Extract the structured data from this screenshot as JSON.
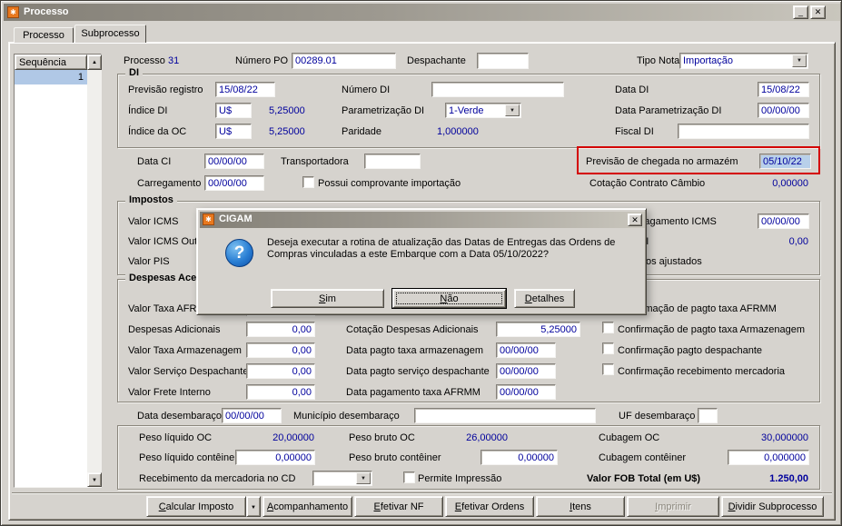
{
  "colors": {
    "value_text": "#00009c",
    "annotation_red": "#d40000",
    "field_highlight": "#b8d0ea",
    "window_bg": "#d6d3ce"
  },
  "glyphs": {
    "app_icon": "✱",
    "minimize": "_",
    "close": "✕",
    "dropdown": "▼",
    "scroll_up": "▲",
    "scroll_down": "▼",
    "question": "?"
  },
  "window": {
    "title": "Processo"
  },
  "tabs": {
    "processo": "Processo",
    "subprocesso": "Subprocesso"
  },
  "sequencia": {
    "header": "Sequência",
    "row1": "1"
  },
  "top": {
    "processo_label": "Processo",
    "processo_value": "31",
    "numero_po_label": "Número PO",
    "numero_po_value": "00289.01",
    "despachante_label": "Despachante",
    "despachante_value": "",
    "tipo_nota_label": "Tipo Nota",
    "tipo_nota_value": "Importação"
  },
  "di": {
    "title": "DI",
    "previsao_registro_label": "Previsão registro",
    "previsao_registro_value": "15/08/22",
    "numero_di_label": "Número DI",
    "numero_di_value": "",
    "data_di_label": "Data DI",
    "data_di_value": "15/08/22",
    "indice_di_label": "Índice DI",
    "indice_di_moeda": "U$",
    "indice_di_taxa": "5,25000",
    "parametrizacao_di_label": "Parametrização DI",
    "parametrizacao_di_value": "1-Verde",
    "data_parametrizacao_di_label": "Data Parametrização DI",
    "data_parametrizacao_di_value": "00/00/00",
    "indice_oc_label": "Índice da OC",
    "indice_oc_moeda": "U$",
    "indice_oc_taxa": "5,25000",
    "paridade_label": "Paridade",
    "paridade_value": "1,000000",
    "fiscal_di_label": "Fiscal DI",
    "fiscal_di_value": ""
  },
  "mid": {
    "data_ci_label": "Data CI",
    "data_ci_value": "00/00/00",
    "transportadora_label": "Transportadora",
    "transportadora_value": "",
    "previsao_chegada_label": "Previsão de chegada no armazém",
    "previsao_chegada_value": "05/10/22",
    "carregamento_label": "Carregamento",
    "carregamento_value": "00/00/00",
    "possui_comprovante_label": "Possui comprovante importação",
    "cotacao_contrato_label": "Cotação Contrato Câmbio",
    "cotacao_contrato_value": "0,00000"
  },
  "impostos": {
    "title": "Impostos",
    "valor_icms_label": "Valor ICMS",
    "valor_icms_value": "",
    "valor_icms_outros_label": "Valor ICMS Outros",
    "valor_icms_outros_value": "",
    "valor_pis_label": "Valor PIS",
    "valor_pis_value": "",
    "data_pagamento_icms_label": "Data pagamento ICMS",
    "data_pagamento_icms_value": "00/00/00",
    "valor_ipi_label": "Valor IPI",
    "valor_ipi_value": "0,00",
    "impostos_ajustados_label": "Impostos ajustados"
  },
  "despesas": {
    "title": "Despesas Acessórias",
    "valor_taxa_afrmm_label": "Valor Taxa AFRMM",
    "valor_taxa_afrmm_value": "",
    "despesas_adicionais_label": "Despesas Adicionais",
    "despesas_adicionais_value": "0,00",
    "valor_taxa_armazenagem_label": "Valor Taxa Armazenagem",
    "valor_taxa_armazenagem_value": "0,00",
    "valor_servico_despachante_label": "Valor Serviço Despachante",
    "valor_servico_despachante_value": "0,00",
    "valor_frete_interno_label": "Valor Frete Interno",
    "valor_frete_interno_value": "0,00",
    "cotacao_despesas_label": "Cotação Despesas Adicionais",
    "cotacao_despesas_value": "5,25000",
    "data_pagto_armazenagem_label": "Data pagto taxa armazenagem",
    "data_pagto_armazenagem_value": "00/00/00",
    "data_pagto_despachante_label": "Data pagto serviço despachante",
    "data_pagto_despachante_value": "00/00/00",
    "data_pagamento_afrmm_label": "Data pagamento taxa AFRMM",
    "data_pagamento_afrmm_value": "00/00/00",
    "conf_afrmm_label": "Confirmação de pagto taxa AFRMM",
    "conf_armazenagem_label": "Confirmação de pagto taxa Armazenagem",
    "conf_despachante_label": "Confirmação pagto despachante",
    "conf_recebimento_label": "Confirmação recebimento mercadoria"
  },
  "desembaraco": {
    "data_label": "Data desembaraço",
    "data_value": "00/00/00",
    "municipio_label": "Município desembaraço",
    "municipio_value": "",
    "uf_label": "UF desembaraço",
    "uf_value": ""
  },
  "totais": {
    "peso_liquido_oc_label": "Peso líquido OC",
    "peso_liquido_oc_value": "20,00000",
    "peso_bruto_oc_label": "Peso bruto OC",
    "peso_bruto_oc_value": "26,00000",
    "cubagem_oc_label": "Cubagem OC",
    "cubagem_oc_value": "30,000000",
    "peso_liquido_conteiner_label": "Peso líquido contêiner",
    "peso_liquido_conteiner_value": "0,00000",
    "peso_bruto_conteiner_label": "Peso bruto contêiner",
    "peso_bruto_conteiner_value": "0,00000",
    "cubagem_conteiner_label": "Cubagem contêiner",
    "cubagem_conteiner_value": "0,000000",
    "recebimento_cd_label": "Recebimento da mercadoria no CD",
    "recebimento_cd_value": "",
    "permite_impressao_label": "Permite Impressão",
    "valor_fob_label": "Valor FOB Total (em U$)",
    "valor_fob_value": "1.250,00"
  },
  "acoes": {
    "calcular_imposto": "Calcular Imposto",
    "acompanhamento": "Acompanhamento",
    "efetivar_nf": "Efetivar NF",
    "efetivar_ordens": "Efetivar Ordens",
    "itens": "Itens",
    "imprimir": "Imprimir",
    "dividir_subprocesso": "Dividir Subprocesso"
  },
  "dialog": {
    "title": "CIGAM",
    "message_line1": "Deseja executar a rotina de atualização das Datas de Entregas das Ordens de",
    "message_line2": "Compras vinculadas a este Embarque com a Data 05/10/2022?",
    "sim": "Sim",
    "nao": "Não",
    "detalhes": "Detalhes"
  }
}
